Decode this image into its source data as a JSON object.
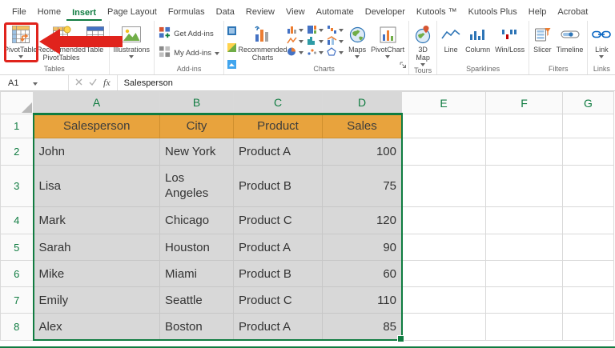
{
  "colors": {
    "accent_green": "#107C41",
    "header_fill": "#E8A33D",
    "selection_fill": "#D8D8D8",
    "annotation_red": "#E0231C"
  },
  "ribbon": {
    "tabs": [
      "File",
      "Home",
      "Insert",
      "Page Layout",
      "Formulas",
      "Data",
      "Review",
      "View",
      "Automate",
      "Developer",
      "Kutools ™",
      "Kutools Plus",
      "Help",
      "Acrobat"
    ],
    "active_tab": "Insert",
    "groups": {
      "tables": {
        "label": "Tables",
        "pivottable": "PivotTable",
        "recommended_pivottables": "Recommended PivotTables",
        "table": "Table"
      },
      "illustrations": {
        "button": "Illustrations"
      },
      "addins": {
        "label": "Add-ins",
        "get_addins": "Get Add-ins",
        "my_addins": "My Add-ins"
      },
      "charts": {
        "label": "Charts",
        "recommended_charts": "Recommended Charts",
        "maps": "Maps",
        "pivotchart": "PivotChart"
      },
      "tours": {
        "label": "Tours",
        "map3d": "3D Map"
      },
      "sparklines": {
        "label": "Sparklines",
        "line": "Line",
        "column": "Column",
        "winloss": "Win/Loss"
      },
      "filters": {
        "label": "Filters",
        "slicer": "Slicer",
        "timeline": "Timeline"
      },
      "links": {
        "label": "Links",
        "link": "Link"
      }
    }
  },
  "formula_bar": {
    "name_box": "A1",
    "fx": "fx",
    "formula": "Salesperson"
  },
  "sheet": {
    "col_headers": [
      "A",
      "B",
      "C",
      "D",
      "E",
      "F",
      "G"
    ],
    "selected_range": "A1:D8",
    "row_numbers": [
      "1",
      "2",
      "3",
      "4",
      "5",
      "6",
      "7",
      "8"
    ],
    "cells": {
      "r1": [
        "Salesperson",
        "City",
        "Product",
        "Sales"
      ],
      "r2": [
        "John",
        "New York",
        "Product A",
        "100"
      ],
      "r3": [
        "Lisa",
        "Los Angeles",
        "Product B",
        "75"
      ],
      "r4": [
        "Mark",
        "Chicago",
        "Product C",
        "120"
      ],
      "r5": [
        "Sarah",
        "Houston",
        "Product A",
        "90"
      ],
      "r6": [
        "Mike",
        "Miami",
        "Product B",
        "60"
      ],
      "r7": [
        "Emily",
        "Seattle",
        "Product C",
        "110"
      ],
      "r8": [
        "Alex",
        "Boston",
        "Product A",
        "85"
      ]
    }
  }
}
